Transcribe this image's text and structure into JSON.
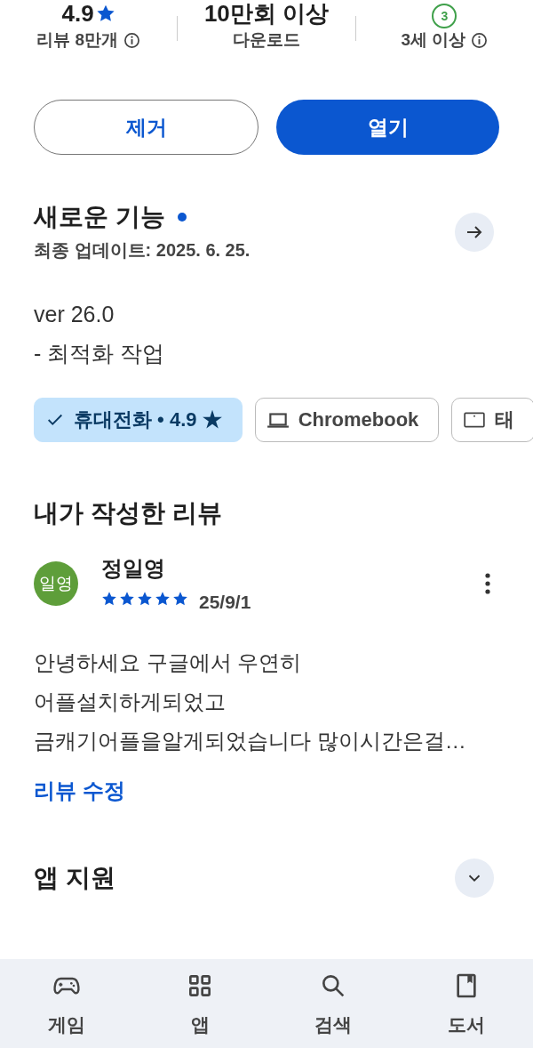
{
  "stats": [
    {
      "kind": "rating",
      "value": "4.9",
      "label": "리뷰 8만개",
      "info": true
    },
    {
      "kind": "downloads",
      "value": "10만회 이상",
      "label": "다운로드",
      "info": false
    },
    {
      "kind": "age",
      "value": "3",
      "label": "3세 이상",
      "info": true
    }
  ],
  "buttons": [
    {
      "kind": "outlined",
      "label": "제거"
    },
    {
      "kind": "filled",
      "label": "열기"
    }
  ],
  "whats_new": {
    "title": "새로운 기능",
    "new_dot": true,
    "updated": "최종 업데이트: 2025. 6. 25.",
    "notes": [
      "ver 26.0",
      "- 최적화 작업"
    ]
  },
  "device_chips": [
    {
      "label": "휴대전화 • 4.9 ★",
      "selected": true
    },
    {
      "kind": "laptop",
      "label": "Chromebook",
      "selected": false
    },
    {
      "kind": "tablet",
      "label": "태",
      "selected": false
    }
  ],
  "my_review": {
    "title": "내가 작성한 리뷰",
    "avatar": "일영",
    "author": "정일영",
    "stars": 5,
    "date": "25/9/1",
    "text": "안녕하세요 구글에서 우연히\n어플설치하게되었고\n금캐기어플을알게되었습니다 많이시간은걸…",
    "edit_link": "리뷰 수정"
  },
  "app_support": {
    "title": "앱 지원",
    "expanded": false
  },
  "nav": [
    {
      "kind": "games",
      "label": "게임"
    },
    {
      "kind": "apps",
      "label": "앱"
    },
    {
      "kind": "search",
      "label": "검색"
    },
    {
      "kind": "books",
      "label": "도서"
    }
  ]
}
